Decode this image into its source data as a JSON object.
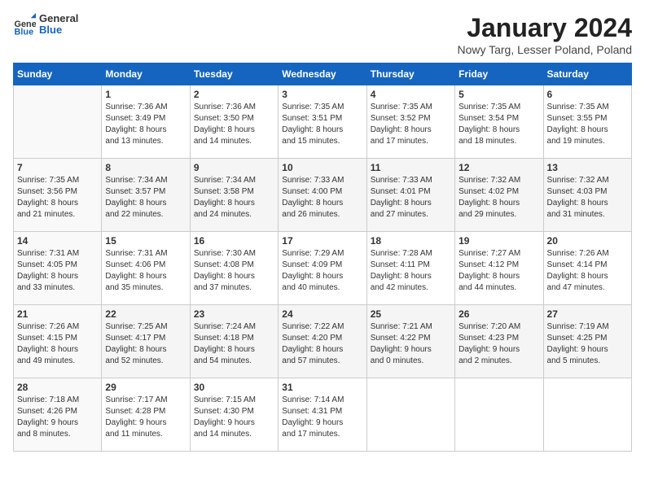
{
  "header": {
    "logo": {
      "general": "General",
      "blue": "Blue"
    },
    "title": "January 2024",
    "subtitle": "Nowy Targ, Lesser Poland, Poland"
  },
  "calendar": {
    "days_of_week": [
      "Sunday",
      "Monday",
      "Tuesday",
      "Wednesday",
      "Thursday",
      "Friday",
      "Saturday"
    ],
    "weeks": [
      [
        {
          "day": "",
          "info": ""
        },
        {
          "day": "1",
          "info": "Sunrise: 7:36 AM\nSunset: 3:49 PM\nDaylight: 8 hours\nand 13 minutes."
        },
        {
          "day": "2",
          "info": "Sunrise: 7:36 AM\nSunset: 3:50 PM\nDaylight: 8 hours\nand 14 minutes."
        },
        {
          "day": "3",
          "info": "Sunrise: 7:35 AM\nSunset: 3:51 PM\nDaylight: 8 hours\nand 15 minutes."
        },
        {
          "day": "4",
          "info": "Sunrise: 7:35 AM\nSunset: 3:52 PM\nDaylight: 8 hours\nand 17 minutes."
        },
        {
          "day": "5",
          "info": "Sunrise: 7:35 AM\nSunset: 3:54 PM\nDaylight: 8 hours\nand 18 minutes."
        },
        {
          "day": "6",
          "info": "Sunrise: 7:35 AM\nSunset: 3:55 PM\nDaylight: 8 hours\nand 19 minutes."
        }
      ],
      [
        {
          "day": "7",
          "info": "Sunrise: 7:35 AM\nSunset: 3:56 PM\nDaylight: 8 hours\nand 21 minutes."
        },
        {
          "day": "8",
          "info": "Sunrise: 7:34 AM\nSunset: 3:57 PM\nDaylight: 8 hours\nand 22 minutes."
        },
        {
          "day": "9",
          "info": "Sunrise: 7:34 AM\nSunset: 3:58 PM\nDaylight: 8 hours\nand 24 minutes."
        },
        {
          "day": "10",
          "info": "Sunrise: 7:33 AM\nSunset: 4:00 PM\nDaylight: 8 hours\nand 26 minutes."
        },
        {
          "day": "11",
          "info": "Sunrise: 7:33 AM\nSunset: 4:01 PM\nDaylight: 8 hours\nand 27 minutes."
        },
        {
          "day": "12",
          "info": "Sunrise: 7:32 AM\nSunset: 4:02 PM\nDaylight: 8 hours\nand 29 minutes."
        },
        {
          "day": "13",
          "info": "Sunrise: 7:32 AM\nSunset: 4:03 PM\nDaylight: 8 hours\nand 31 minutes."
        }
      ],
      [
        {
          "day": "14",
          "info": "Sunrise: 7:31 AM\nSunset: 4:05 PM\nDaylight: 8 hours\nand 33 minutes."
        },
        {
          "day": "15",
          "info": "Sunrise: 7:31 AM\nSunset: 4:06 PM\nDaylight: 8 hours\nand 35 minutes."
        },
        {
          "day": "16",
          "info": "Sunrise: 7:30 AM\nSunset: 4:08 PM\nDaylight: 8 hours\nand 37 minutes."
        },
        {
          "day": "17",
          "info": "Sunrise: 7:29 AM\nSunset: 4:09 PM\nDaylight: 8 hours\nand 40 minutes."
        },
        {
          "day": "18",
          "info": "Sunrise: 7:28 AM\nSunset: 4:11 PM\nDaylight: 8 hours\nand 42 minutes."
        },
        {
          "day": "19",
          "info": "Sunrise: 7:27 AM\nSunset: 4:12 PM\nDaylight: 8 hours\nand 44 minutes."
        },
        {
          "day": "20",
          "info": "Sunrise: 7:26 AM\nSunset: 4:14 PM\nDaylight: 8 hours\nand 47 minutes."
        }
      ],
      [
        {
          "day": "21",
          "info": "Sunrise: 7:26 AM\nSunset: 4:15 PM\nDaylight: 8 hours\nand 49 minutes."
        },
        {
          "day": "22",
          "info": "Sunrise: 7:25 AM\nSunset: 4:17 PM\nDaylight: 8 hours\nand 52 minutes."
        },
        {
          "day": "23",
          "info": "Sunrise: 7:24 AM\nSunset: 4:18 PM\nDaylight: 8 hours\nand 54 minutes."
        },
        {
          "day": "24",
          "info": "Sunrise: 7:22 AM\nSunset: 4:20 PM\nDaylight: 8 hours\nand 57 minutes."
        },
        {
          "day": "25",
          "info": "Sunrise: 7:21 AM\nSunset: 4:22 PM\nDaylight: 9 hours\nand 0 minutes."
        },
        {
          "day": "26",
          "info": "Sunrise: 7:20 AM\nSunset: 4:23 PM\nDaylight: 9 hours\nand 2 minutes."
        },
        {
          "day": "27",
          "info": "Sunrise: 7:19 AM\nSunset: 4:25 PM\nDaylight: 9 hours\nand 5 minutes."
        }
      ],
      [
        {
          "day": "28",
          "info": "Sunrise: 7:18 AM\nSunset: 4:26 PM\nDaylight: 9 hours\nand 8 minutes."
        },
        {
          "day": "29",
          "info": "Sunrise: 7:17 AM\nSunset: 4:28 PM\nDaylight: 9 hours\nand 11 minutes."
        },
        {
          "day": "30",
          "info": "Sunrise: 7:15 AM\nSunset: 4:30 PM\nDaylight: 9 hours\nand 14 minutes."
        },
        {
          "day": "31",
          "info": "Sunrise: 7:14 AM\nSunset: 4:31 PM\nDaylight: 9 hours\nand 17 minutes."
        },
        {
          "day": "",
          "info": ""
        },
        {
          "day": "",
          "info": ""
        },
        {
          "day": "",
          "info": ""
        }
      ]
    ]
  }
}
